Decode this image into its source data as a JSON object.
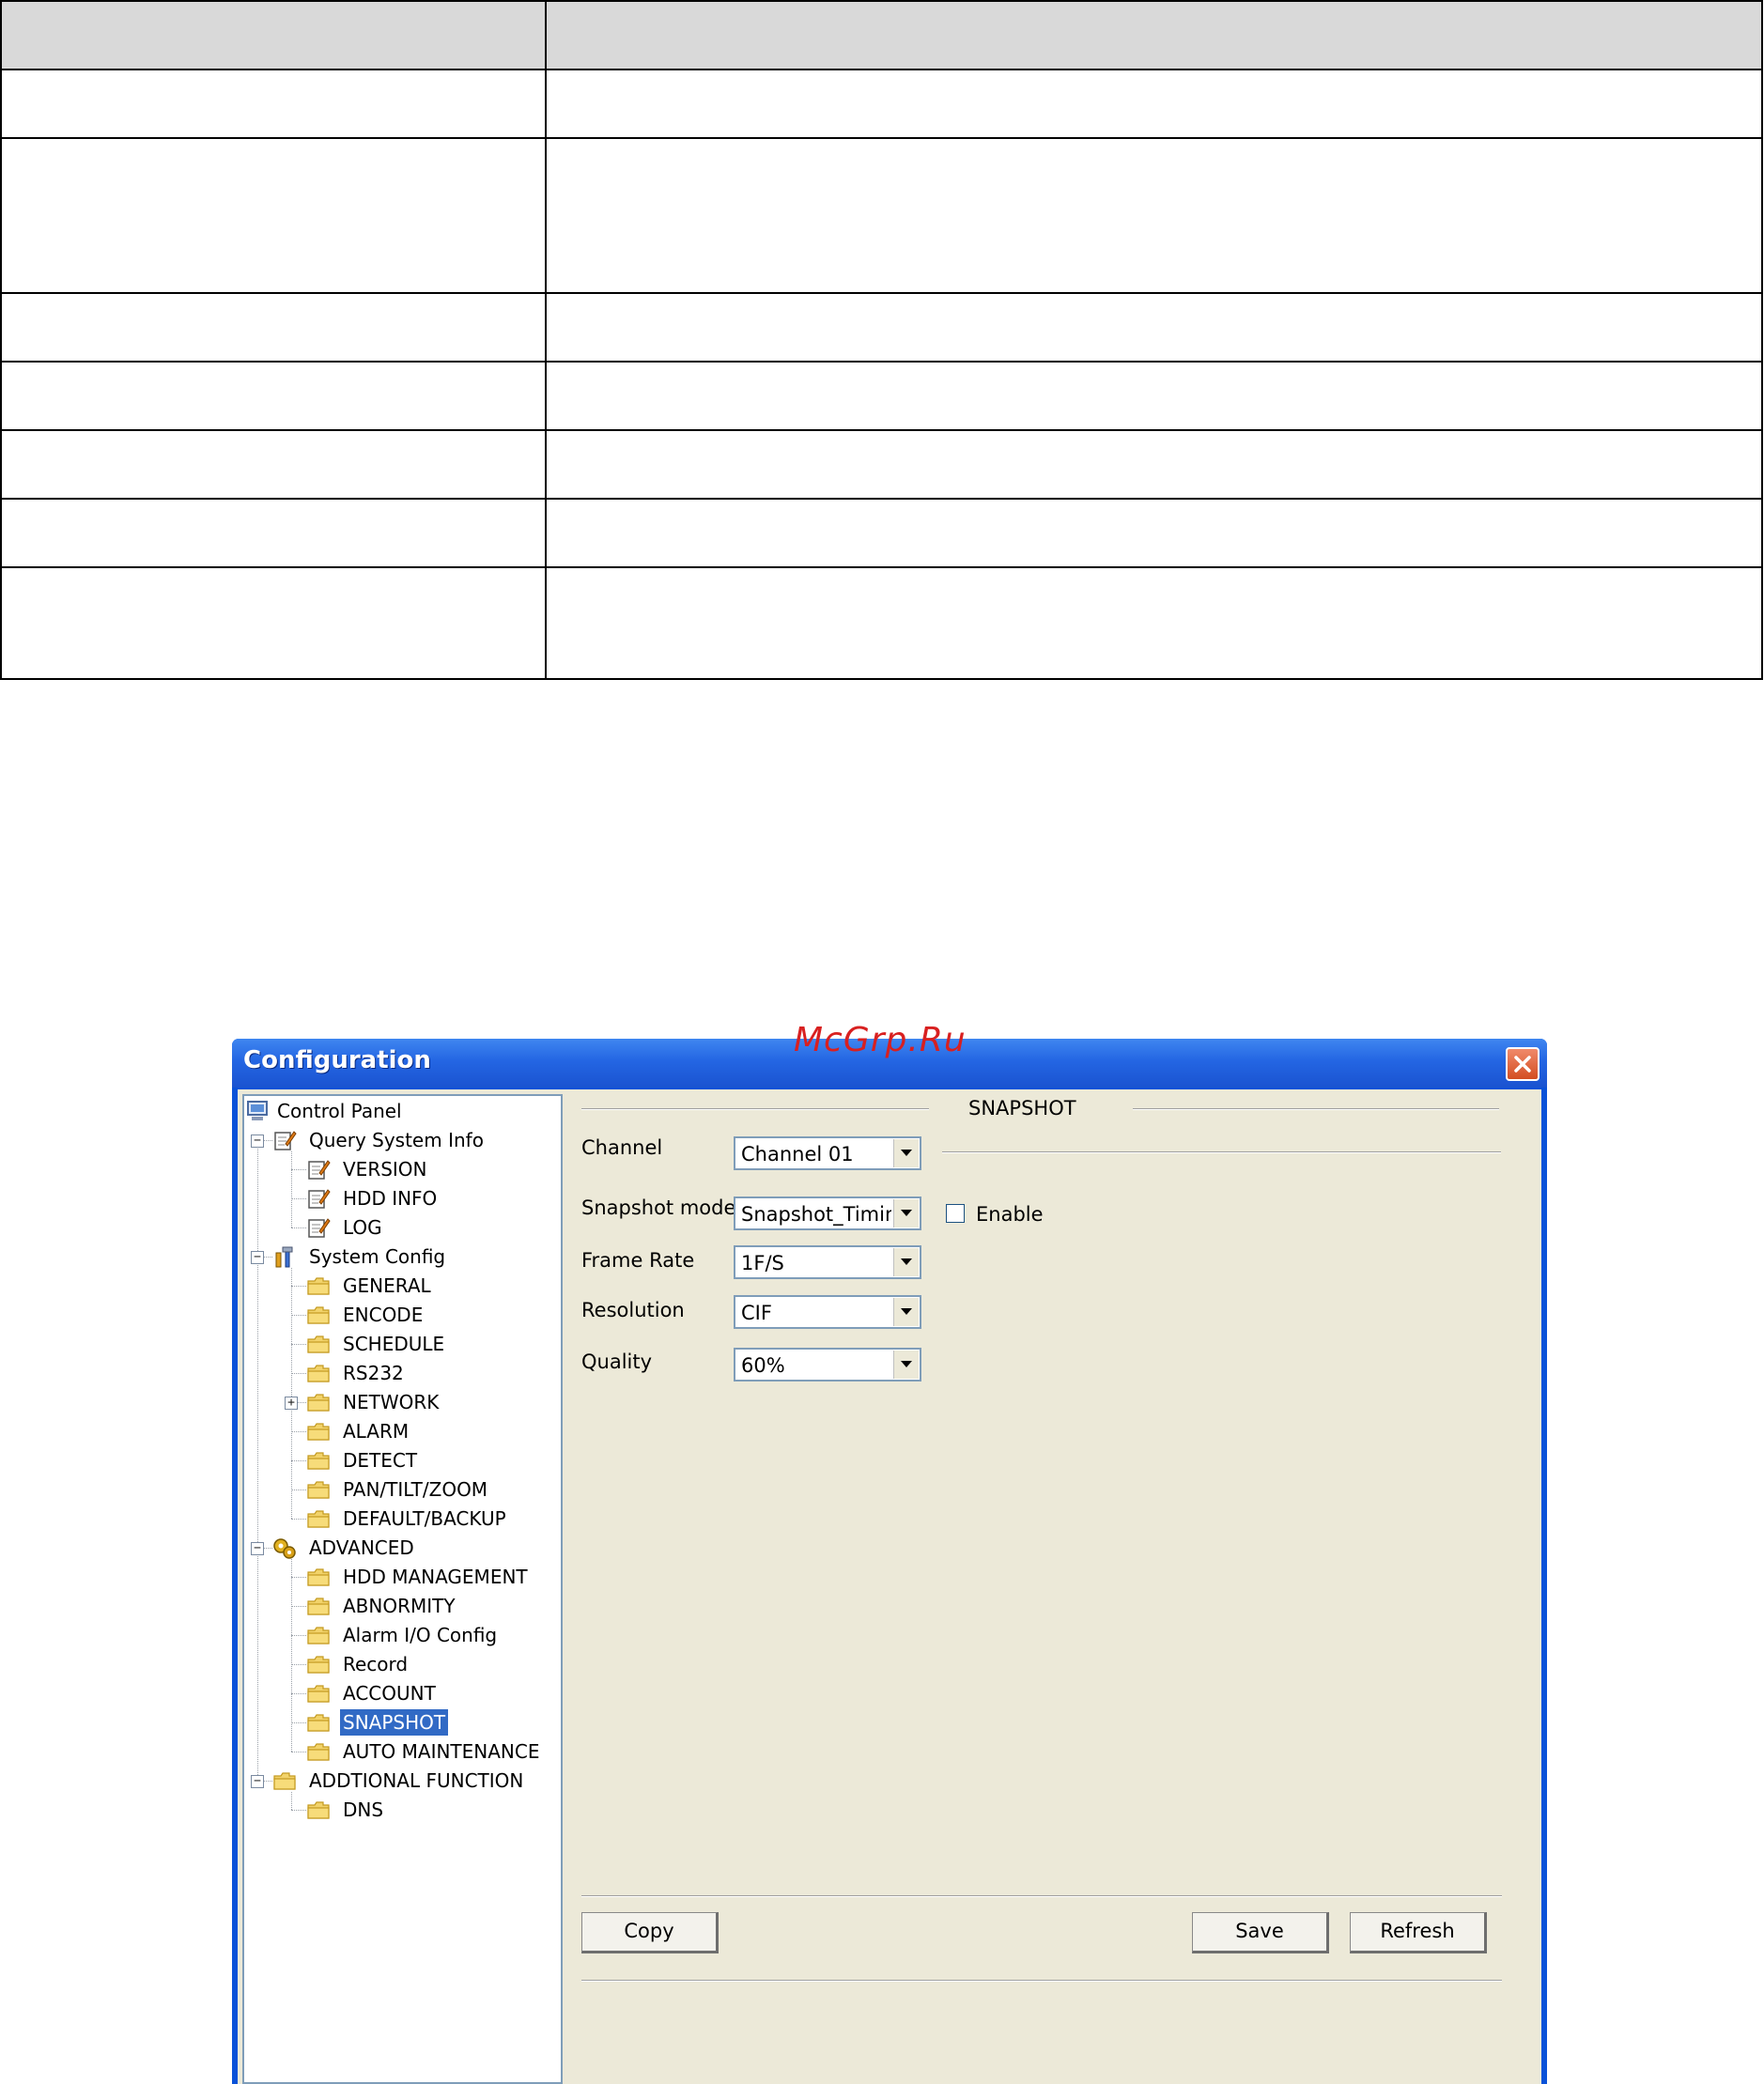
{
  "watermark": "McGrp.Ru",
  "window": {
    "title": "Configuration"
  },
  "tree": {
    "items": [
      {
        "label": "Control Panel"
      },
      {
        "label": "Query System Info"
      },
      {
        "label": "VERSION"
      },
      {
        "label": "HDD INFO"
      },
      {
        "label": "LOG"
      },
      {
        "label": "System Config"
      },
      {
        "label": "GENERAL"
      },
      {
        "label": "ENCODE"
      },
      {
        "label": "SCHEDULE"
      },
      {
        "label": "RS232"
      },
      {
        "label": "NETWORK"
      },
      {
        "label": "ALARM"
      },
      {
        "label": "DETECT"
      },
      {
        "label": "PAN/TILT/ZOOM"
      },
      {
        "label": "DEFAULT/BACKUP"
      },
      {
        "label": "ADVANCED"
      },
      {
        "label": "HDD MANAGEMENT"
      },
      {
        "label": "ABNORMITY"
      },
      {
        "label": "Alarm I/O Config"
      },
      {
        "label": "Record"
      },
      {
        "label": "ACCOUNT"
      },
      {
        "label": "SNAPSHOT"
      },
      {
        "label": "AUTO MAINTENANCE"
      },
      {
        "label": "ADDTIONAL FUNCTION"
      },
      {
        "label": "DNS"
      }
    ],
    "selected": "SNAPSHOT"
  },
  "snapshot": {
    "section_title": "SNAPSHOT",
    "channel_label": "Channel",
    "channel_value": "Channel 01",
    "mode_label": "Snapshot mode",
    "mode_value": "Snapshot_Timing",
    "enable_label": "Enable",
    "enable_checked": false,
    "frame_rate_label": "Frame Rate",
    "frame_rate_value": "1F/S",
    "resolution_label": "Resolution",
    "resolution_value": "CIF",
    "quality_label": "Quality",
    "quality_value": "60%"
  },
  "buttons": {
    "copy": "Copy",
    "save": "Save",
    "refresh": "Refresh"
  }
}
